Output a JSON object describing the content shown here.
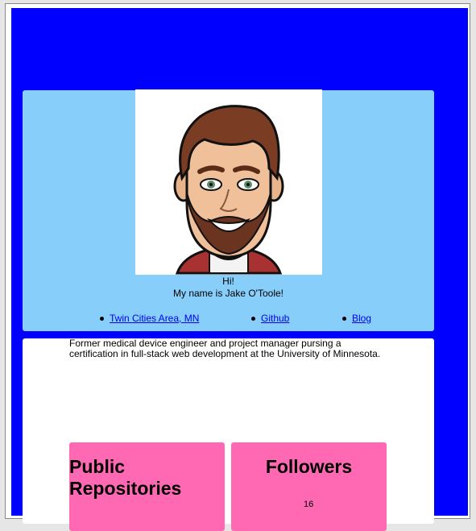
{
  "profile": {
    "greeting": "Hi!",
    "name_line": "My name is Jake O'Toole!",
    "avatar_alt": "bitmoji-avatar"
  },
  "links": {
    "location": "Twin Cities Area, MN",
    "github": "Github",
    "blog": "Blog"
  },
  "bio": {
    "text": "Former medical device engineer and project manager pursing a certification in full-stack web development at the University of Minnesota."
  },
  "stats": {
    "repos_title": "Public Repositories",
    "followers_title": "Followers",
    "followers_count": "16"
  },
  "colors": {
    "page_blue": "#0000ff",
    "header_card": "#87cefa",
    "stat_card": "#ff69b4",
    "link": "#0000ee"
  }
}
